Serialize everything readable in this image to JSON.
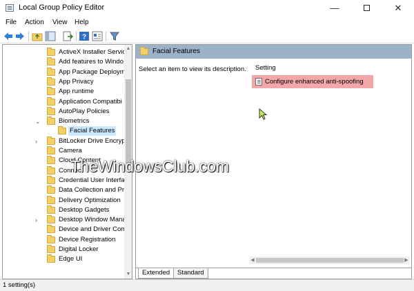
{
  "window": {
    "title": "Local Group Policy Editor",
    "minimize": "—",
    "close": "✕"
  },
  "menu": [
    "File",
    "Action",
    "View",
    "Help"
  ],
  "tree": {
    "items": [
      {
        "label": "ActiveX Installer Servic",
        "expander": ""
      },
      {
        "label": "Add features to Windo",
        "expander": ""
      },
      {
        "label": "App Package Deploym",
        "expander": ""
      },
      {
        "label": "App Privacy",
        "expander": ""
      },
      {
        "label": "App runtime",
        "expander": ""
      },
      {
        "label": "Application Compatibi",
        "expander": ""
      },
      {
        "label": "AutoPlay Policies",
        "expander": ""
      },
      {
        "label": "Biometrics",
        "expander": "⌄"
      },
      {
        "label": "Facial Features",
        "expander": "",
        "selected": true
      },
      {
        "label": "BitLocker Drive Encrypt",
        "expander": "›"
      },
      {
        "label": "Camera",
        "expander": ""
      },
      {
        "label": "Cloud Content",
        "expander": ""
      },
      {
        "label": "Connect",
        "expander": ""
      },
      {
        "label": "Credential User Interfac",
        "expander": ""
      },
      {
        "label": "Data Collection and Pr",
        "expander": ""
      },
      {
        "label": "Delivery Optimization",
        "expander": ""
      },
      {
        "label": "Desktop Gadgets",
        "expander": ""
      },
      {
        "label": "Desktop Window Mana",
        "expander": "›"
      },
      {
        "label": "Device and Driver Com",
        "expander": ""
      },
      {
        "label": "Device Registration",
        "expander": ""
      },
      {
        "label": "Digital Locker",
        "expander": ""
      },
      {
        "label": "Edge UI",
        "expander": ""
      }
    ]
  },
  "right": {
    "header": "Facial Features",
    "description": "Select an item to view its description.",
    "column_header": "Setting",
    "setting": "Configure enhanced anti-spoofing"
  },
  "watermark": "TheWindowsClub.com",
  "tabs": [
    "Extended",
    "Standard"
  ],
  "status": "1 setting(s)",
  "colors": {
    "header": "#9bb2c9",
    "highlight": "#f2a7aa",
    "selection": "#cce8ff",
    "folder": "#f3cf68"
  }
}
